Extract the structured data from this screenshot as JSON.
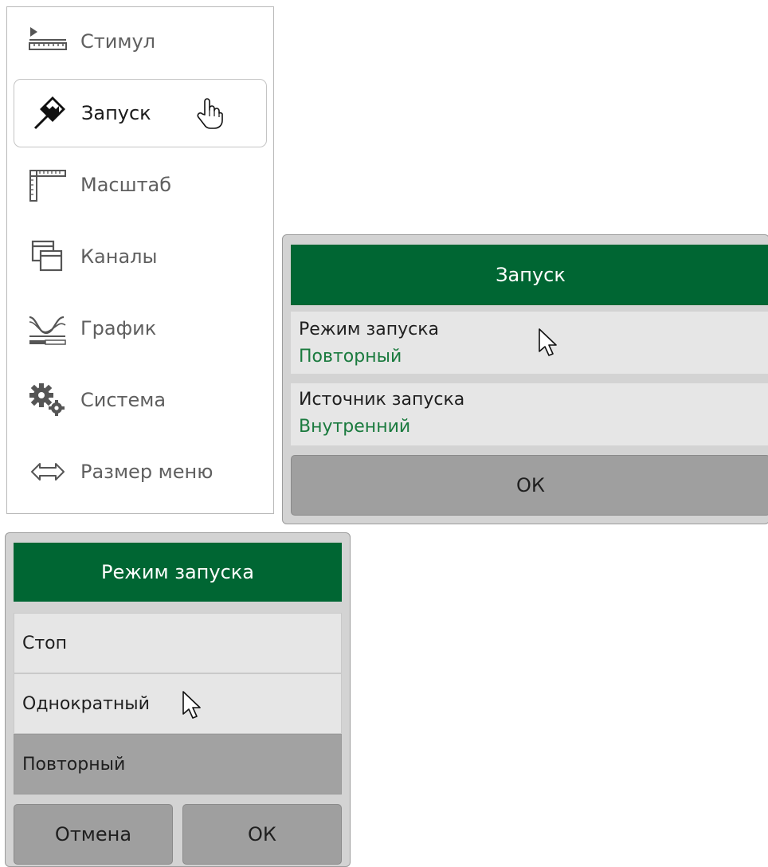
{
  "side_menu": {
    "items": [
      {
        "label": "Стимул",
        "icon": "ruler-stimulus-icon"
      },
      {
        "label": "Запуск",
        "icon": "trigger-flag-icon",
        "active": true
      },
      {
        "label": "Масштаб",
        "icon": "scale-icon"
      },
      {
        "label": "Каналы",
        "icon": "channels-windows-icon"
      },
      {
        "label": "График",
        "icon": "trace-graph-icon"
      },
      {
        "label": "Система",
        "icon": "system-gears-icon"
      },
      {
        "label": "Размер меню",
        "icon": "menu-size-arrows-icon"
      }
    ]
  },
  "trigger_dialog": {
    "title": "Запуск",
    "fields": [
      {
        "label": "Режим запуска",
        "value": "Повторный"
      },
      {
        "label": "Источник запуска",
        "value": "Внутренний"
      }
    ],
    "ok_label": "ОК"
  },
  "mode_dialog": {
    "title": "Режим запуска",
    "options": [
      {
        "label": "Стоп",
        "selected": false
      },
      {
        "label": "Однократный",
        "selected": false
      },
      {
        "label": "Повторный",
        "selected": true
      }
    ],
    "cancel_label": "Отмена",
    "ok_label": "ОК"
  },
  "colors": {
    "header_green": "#006633",
    "value_green": "#1a7a3e",
    "selected_gray": "#a2a2a2",
    "button_gray": "#9f9f9f"
  }
}
